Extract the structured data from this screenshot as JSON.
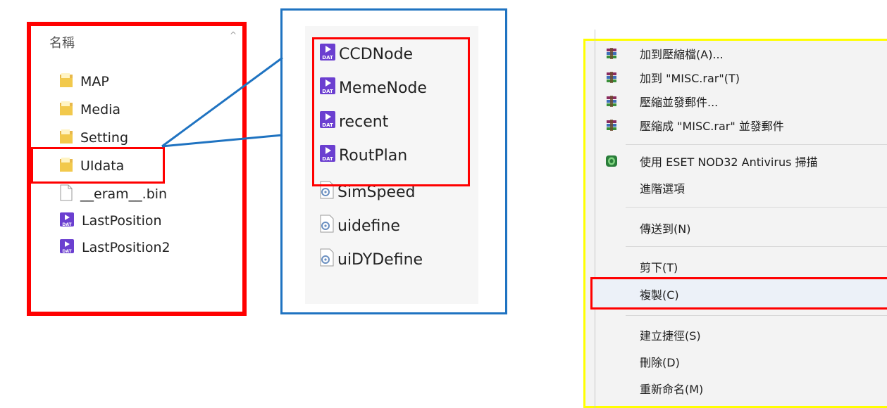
{
  "explorer": {
    "column_header": "名稱",
    "sort_caret": "^",
    "items": [
      {
        "label": "MAP",
        "type": "folder"
      },
      {
        "label": "Media",
        "type": "folder"
      },
      {
        "label": "Setting",
        "type": "folder"
      },
      {
        "label": "UIdata",
        "type": "folder",
        "highlighted": true
      },
      {
        "label": "__eram__.bin",
        "type": "file"
      },
      {
        "label": "LastPosition",
        "type": "dat"
      },
      {
        "label": "LastPosition2",
        "type": "dat"
      }
    ]
  },
  "uidata_zoom": {
    "items": [
      {
        "label": "CCDNode",
        "type": "dat",
        "highlighted": true
      },
      {
        "label": "MemeNode",
        "type": "dat",
        "highlighted": true
      },
      {
        "label": "recent",
        "type": "dat",
        "highlighted": true
      },
      {
        "label": "RoutPlan",
        "type": "dat",
        "highlighted": true
      },
      {
        "label": "SimSpeed",
        "type": "config"
      },
      {
        "label": "uidefine",
        "type": "config"
      },
      {
        "label": "uiDYDefine",
        "type": "config"
      }
    ],
    "dat_badge": "DAT"
  },
  "context_menu": {
    "items": [
      {
        "label": "加到壓縮檔(A)...",
        "icon": "winrar-icon"
      },
      {
        "label": "加到 \"MISC.rar\"(T)",
        "icon": "winrar-icon"
      },
      {
        "label": "壓縮並發郵件...",
        "icon": "winrar-icon"
      },
      {
        "label": "壓縮成 \"MISC.rar\" 並發郵件",
        "icon": "winrar-icon"
      },
      {
        "label": "使用 ESET NOD32 Antivirus 掃描",
        "icon": "eset-icon"
      },
      {
        "label": "進階選項",
        "icon": ""
      },
      {
        "label": "傳送到(N)",
        "icon": ""
      },
      {
        "label": "剪下(T)",
        "icon": ""
      },
      {
        "label": "複製(C)",
        "icon": "",
        "highlighted": true
      },
      {
        "label": "建立捷徑(S)",
        "icon": ""
      },
      {
        "label": "刪除(D)",
        "icon": ""
      },
      {
        "label": "重新命名(M)",
        "icon": ""
      }
    ]
  },
  "colors": {
    "highlight_red": "#ff0000",
    "zoom_blue": "#1f73c1",
    "menu_yellow": "#ffff00",
    "folder_yellow": "#f2c94c",
    "dat_purple": "#6b3fd0"
  }
}
